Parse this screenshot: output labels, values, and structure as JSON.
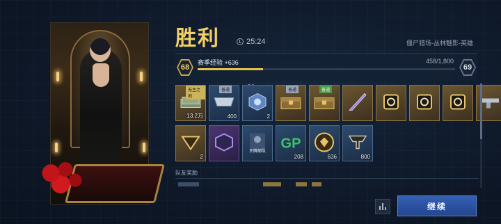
{
  "header": {
    "title": "胜利",
    "time": "25:24",
    "mode": "僵尸猎场-丛林魅影-英雄"
  },
  "level": {
    "current": "68",
    "next": "69",
    "xp_label": "赛季经验 +636",
    "xp_count": "458/1,800",
    "progress": 0.254
  },
  "items_row1": [
    {
      "tag": "无主之地",
      "tag_style": "gold",
      "count": "13.2万",
      "style": "gold",
      "icon": "cash-stack-icon"
    },
    {
      "tag": "普通",
      "tag_style": "gray",
      "count": "400",
      "style": "blue",
      "icon": "ticket-icon"
    },
    {
      "tag": "",
      "tag_style": "",
      "count": "2",
      "style": "blue",
      "icon": "crate-icon"
    },
    {
      "tag": "普通",
      "tag_style": "gray",
      "count": "",
      "style": "gold",
      "icon": "chest-icon"
    },
    {
      "tag": "普通",
      "tag_style": "green",
      "count": "",
      "style": "gold",
      "icon": "chest-gold-icon"
    },
    {
      "tag": "",
      "tag_style": "",
      "count": "",
      "style": "gold",
      "icon": "blade-icon"
    },
    {
      "tag": "",
      "tag_style": "",
      "count": "",
      "style": "gold",
      "icon": "emblem-icon"
    },
    {
      "tag": "",
      "tag_style": "",
      "count": "",
      "style": "gold",
      "icon": "hand-card-icon"
    },
    {
      "tag": "",
      "tag_style": "",
      "count": "",
      "style": "gold",
      "icon": "badge-icon"
    },
    {
      "tag": "",
      "tag_style": "",
      "count": "",
      "style": "gold",
      "icon": "gun-icon"
    }
  ],
  "items_row2": [
    {
      "count": "2",
      "style": "gold",
      "icon": "shield-arrow-icon"
    },
    {
      "count": "",
      "style": "purple",
      "icon": "hex-emblem-icon"
    },
    {
      "count": "",
      "style": "blue",
      "icon": "character-card-icon",
      "caption": "王牌部队"
    },
    {
      "count": "208",
      "style": "blue",
      "icon": "gp-icon",
      "text": "GP"
    },
    {
      "count": "636",
      "style": "blue",
      "icon": "gold-medal-icon"
    },
    {
      "count": "800",
      "style": "blue",
      "icon": "rank-icon"
    }
  ],
  "s3_label": "S3",
  "section_label": "队友奖励",
  "continue_label": "继续",
  "colors": {
    "accent_gold": "#f2cf67",
    "button_blue": "#2f57a6"
  }
}
